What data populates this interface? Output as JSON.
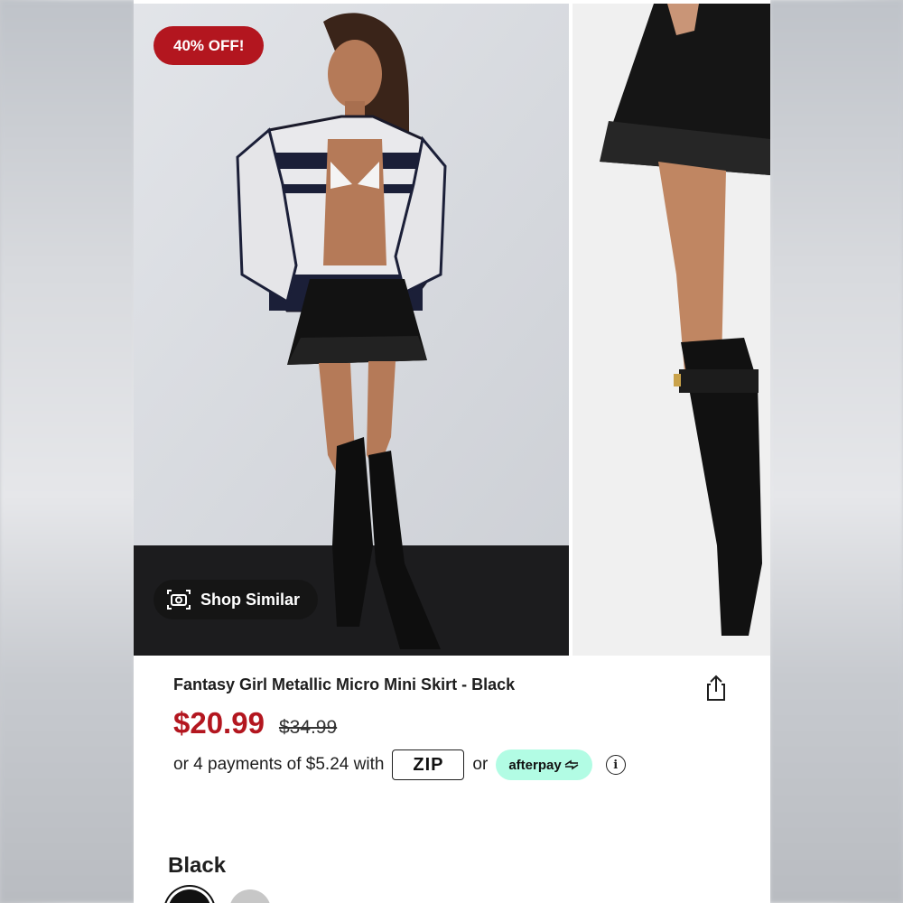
{
  "gallery": {
    "badge": "40% OFF!",
    "shop_similar_label": "Shop Similar",
    "main_image_alt": "Model wearing black metallic micro mini skirt with racing jacket and knee-high boots",
    "side_image_alt": "Close-up of skirt and black knee-high boot"
  },
  "product": {
    "title": "Fantasy Girl Metallic Micro Mini Skirt - Black",
    "price_sale": "$20.99",
    "price_original": "$34.99",
    "installments_text": "or 4 payments of $5.24 with",
    "zip_label": "ZIP",
    "or_text": "or",
    "afterpay_label": "afterpay",
    "info_symbol": "i"
  },
  "color": {
    "selected_label": "Black"
  },
  "colors": {
    "sale_red": "#b3161f",
    "afterpay_mint": "#b2fce4",
    "zip_purple": "#a78bfa"
  },
  "icons": [
    "camera-icon",
    "share-icon",
    "info-icon",
    "afterpay-arrow-icon"
  ]
}
